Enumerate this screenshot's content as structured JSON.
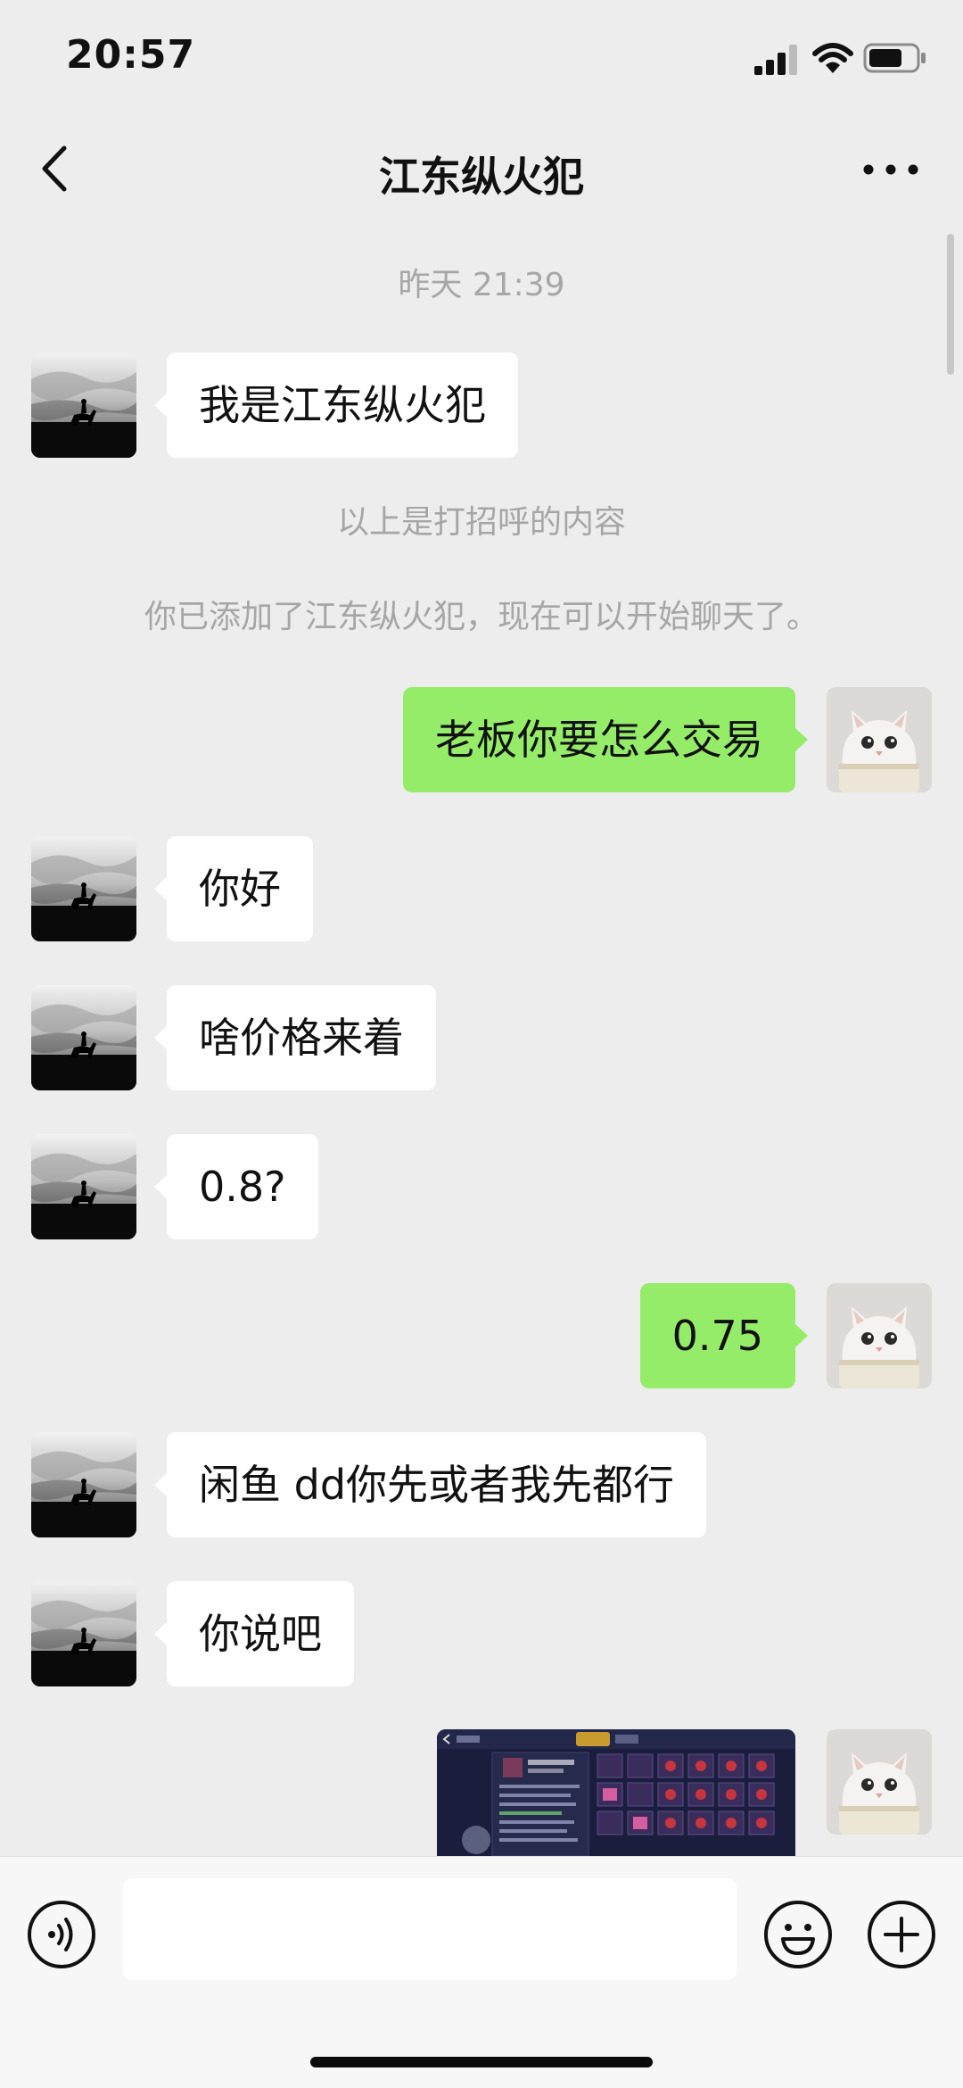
{
  "status_bar": {
    "time": "20:57",
    "icons": [
      "signal-icon",
      "wifi-icon",
      "battery-icon"
    ]
  },
  "nav": {
    "title": "江东纵火犯",
    "back_icon": "chevron-left-icon",
    "more_icon": "more-dots-icon"
  },
  "chat": {
    "timestamp": "昨天 21:39",
    "system_messages": [
      "以上是打招呼的内容",
      "你已添加了江东纵火犯，现在可以开始聊天了。"
    ],
    "messages": [
      {
        "side": "left",
        "text": "我是江东纵火犯"
      },
      {
        "side": "right",
        "text": "老板你要怎么交易"
      },
      {
        "side": "left",
        "text": "你好"
      },
      {
        "side": "left",
        "text": "啥价格来着"
      },
      {
        "side": "left",
        "text": "0.8?"
      },
      {
        "side": "right",
        "text": "0.75"
      },
      {
        "side": "left",
        "text": "闲鱼 dd你先或者我先都行"
      },
      {
        "side": "left",
        "text": "你说吧"
      },
      {
        "side": "right",
        "type": "image",
        "description": "game-screenshot-thumbnail"
      }
    ]
  },
  "input_bar": {
    "value": "",
    "icons": [
      "voice-icon",
      "emoji-icon",
      "plus-icon"
    ]
  },
  "colors": {
    "background": "#ededed",
    "outgoing_bubble": "#95ec69",
    "incoming_bubble": "#ffffff",
    "system_text": "#a6a6a6"
  }
}
